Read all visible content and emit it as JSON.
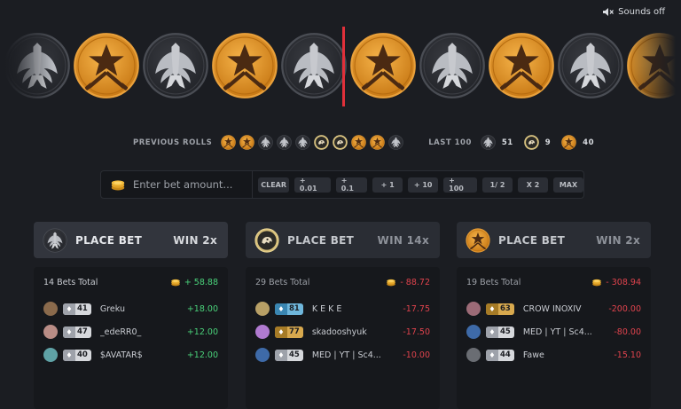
{
  "sound": {
    "label": "Sounds off",
    "icon": "speaker-muted-icon"
  },
  "roller": {
    "coins": [
      "ct",
      "t",
      "ct",
      "t",
      "ct",
      "t",
      "ct",
      "t",
      "ct",
      "t"
    ]
  },
  "history": {
    "previous_label": "PREVIOUS ROLLS",
    "previous": [
      "t",
      "t",
      "ct",
      "ct",
      "ct",
      "bonus",
      "bonus",
      "t",
      "t",
      "ct"
    ],
    "last100_label": "LAST 100",
    "counts": {
      "ct": "51",
      "bonus": "9",
      "t": "40"
    }
  },
  "bet": {
    "placeholder": "Enter bet amount...",
    "buttons": [
      "CLEAR",
      "+ 0.01",
      "+ 0.1",
      "+ 1",
      "+ 10",
      "+ 100",
      "1/ 2",
      "X 2",
      "MAX"
    ]
  },
  "columns": [
    {
      "icon": "counter-terrorist-icon",
      "title": "PLACE BET",
      "win": "WIN 2x",
      "total_label": "14 Bets Total",
      "total": "+ 58.88",
      "rows": [
        {
          "level": "41",
          "badge": "silver",
          "name": "Greku",
          "amount": "+18.00",
          "avatar": "#8a6a4c"
        },
        {
          "level": "47",
          "badge": "silver",
          "name": "_edeRR0_",
          "amount": "+12.00",
          "avatar": "#b98d86"
        },
        {
          "level": "40",
          "badge": "silver",
          "name": "$AVATAR$",
          "amount": "+12.00",
          "avatar": "#5fa2a6"
        }
      ]
    },
    {
      "icon": "bonus-icon",
      "title": "PLACE BET",
      "win": "WIN 14x",
      "total_label": "29 Bets Total",
      "total": "- 88.72",
      "rows": [
        {
          "level": "81",
          "badge": "blue",
          "name": "K E K É",
          "amount": "-17.75",
          "avatar": "#b8a066"
        },
        {
          "level": "77",
          "badge": "gold",
          "name": "skadooshyuk",
          "amount": "-17.50",
          "avatar": "#b07ad0"
        },
        {
          "level": "45",
          "badge": "silver",
          "name": "MED | YT | Sc4...",
          "amount": "-10.00",
          "avatar": "#3e6aa8"
        }
      ]
    },
    {
      "icon": "terrorist-icon",
      "title": "PLACE BET",
      "win": "WIN 2x",
      "total_label": "19 Bets Total",
      "total": "- 308.94",
      "rows": [
        {
          "level": "63",
          "badge": "gold",
          "name": "CROW INOXIV",
          "amount": "-200.00",
          "avatar": "#9c6b77"
        },
        {
          "level": "45",
          "badge": "silver",
          "name": "MED | YT | Sc4...",
          "amount": "-80.00",
          "avatar": "#3e6aa8"
        },
        {
          "level": "44",
          "badge": "silver",
          "name": "Fawe",
          "amount": "-15.10",
          "avatar": "#6a6d73"
        }
      ]
    }
  ],
  "colors": {
    "t_orange": "#e89a2c",
    "ct_gray": "#2c2e33",
    "marker_red": "#e0303a",
    "positive": "#4ad27a",
    "negative": "#e0434d"
  }
}
